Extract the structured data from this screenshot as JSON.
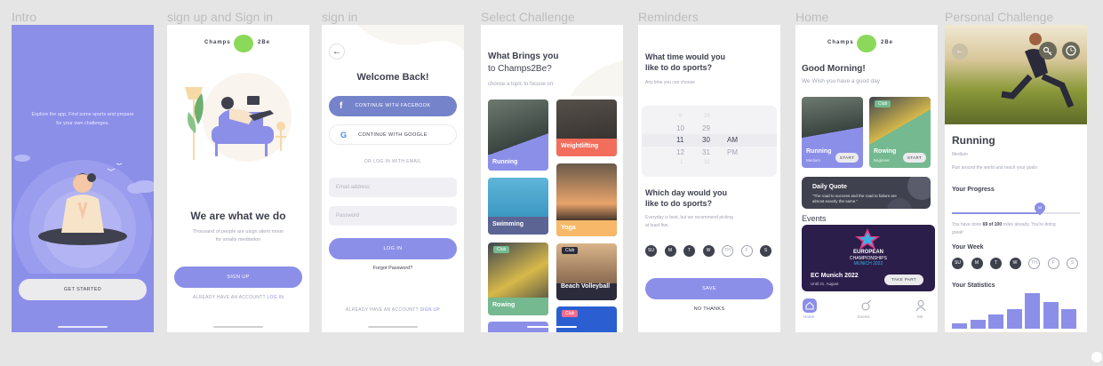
{
  "labels": {
    "intro": "Intro",
    "signup": "sign up and Sign in",
    "signin": "sign in",
    "select": "Select Challenge",
    "reminders": "Reminders",
    "home": "Home",
    "personal": "Personal Challenge"
  },
  "brand": {
    "left": "Champs",
    "right": "2Be"
  },
  "intro": {
    "text_line1": "Explore the app, Find some sports and prepare",
    "text_line2": "for your own challenges.",
    "cta": "GET STARTED"
  },
  "signup": {
    "title": "We are what we do",
    "sub1": "Thousand of people are usign silent moon",
    "sub2": "for smalls meditation",
    "cta": "SIGN UP",
    "have_account": "ALREADY HAVE AN ACCOUNT?",
    "login_link": "LOG IN"
  },
  "signin": {
    "back_icon": "arrow-left",
    "title": "Welcome Back!",
    "facebook": "CONTINUE WITH FACEBOOK",
    "google": "CONTINUE WITH GOOGLE",
    "or_email": "OR LOG IN WITH EMAIL",
    "email_placeholder": "Email address",
    "password_placeholder": "Password",
    "login": "LOG IN",
    "forgot": "Forgot Password?",
    "no_account": "ALREADY HAVE AN ACCOUNT?",
    "signup_link": "SIGN UP"
  },
  "select": {
    "title1": "What Brings you",
    "title2": "to Champs2Be?",
    "sub": "choose a topic to focuse on:",
    "tiles": [
      {
        "label": "Running",
        "color": "#8c8fe8"
      },
      {
        "label": "Weightlifting",
        "color": "#f26d5b"
      },
      {
        "label": "Swimming",
        "color": "#5c6494"
      },
      {
        "label": "Yoga",
        "color": "#f7b869"
      },
      {
        "label": "Rowing",
        "color": "#74b990"
      },
      {
        "label": "Beach Volleyball",
        "color": "#2b2b3c"
      }
    ],
    "badges": [
      "Club",
      "Club",
      "Club"
    ]
  },
  "reminders": {
    "q1_line1": "What time would you",
    "q1_line2": "like to do sports?",
    "any_time": "Any time you can choose",
    "hours": [
      "10",
      "11",
      "12"
    ],
    "minutes": [
      "29",
      "30",
      "31"
    ],
    "ampm": [
      "AM",
      "PM"
    ],
    "faint_top_h": "9",
    "faint_top_m": "28",
    "faint_bottom_h": "1",
    "faint_bottom_m": "32",
    "q2_line1": "Which day would you",
    "q2_line2": "like to do sports?",
    "hint1": "Everyday is best, but we recommend picking",
    "hint2": "at least five.",
    "days": [
      "SU",
      "M",
      "T",
      "W",
      "TH",
      "F",
      "S"
    ],
    "days_selected": [
      true,
      true,
      true,
      true,
      false,
      false,
      true
    ],
    "save": "SAVE",
    "no_thanks": "NO THANKS"
  },
  "home": {
    "greeting": "Good Morning!",
    "wish": "We Wish you have a good day",
    "card1": {
      "title": "Running",
      "level": "Medium",
      "button": "START"
    },
    "card2": {
      "title": "Rowing",
      "level": "Beginner",
      "button": "START",
      "badge": "Club"
    },
    "quote_title": "Daily Quote",
    "quote_line1": "\"The road to success and the road to failure are",
    "quote_line2": "almost exactly the same.\"",
    "events_title": "Events",
    "event_banner_line1": "EUROPEAN",
    "event_banner_line2": "CHAMPIONSHIPS",
    "event_banner_line3": "MUNICH 2022",
    "event_name": "EC Munich 2022",
    "event_date": "Until 21. August",
    "take_part": "TAKE PART",
    "nav": [
      "Home",
      "Events",
      "Me"
    ]
  },
  "personal": {
    "title": "Running",
    "level": "Medium",
    "desc": "Run around the world and reach your goals",
    "progress_title": "Your Progress",
    "progress_value": 69,
    "progress_total": 100,
    "progress_fraction": 0.69,
    "progress_pre": "You have done",
    "progress_amount": "69 of 100",
    "progress_post": "miles already. You're doing",
    "progress_post2": "great!",
    "week_title": "Your Week",
    "days": [
      "SU",
      "M",
      "T",
      "W",
      "TH",
      "F",
      "S"
    ],
    "days_selected": [
      true,
      true,
      true,
      true,
      false,
      false,
      false
    ],
    "stats_title": "Your Statistics",
    "stats_bars": [
      0.15,
      0.25,
      0.4,
      0.55,
      1.0,
      0.75,
      0.55
    ]
  },
  "colors": {
    "accent": "#8c8fe8",
    "dark": "#3f414e",
    "facebook": "#7583ca",
    "intro_bg": "#8c8fe8"
  }
}
